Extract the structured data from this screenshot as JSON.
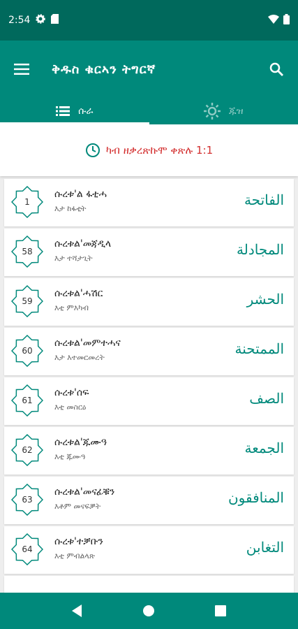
{
  "status": {
    "time": "2:54"
  },
  "app": {
    "title": "ቅዱስ ቁርኣን ትግርኛ"
  },
  "tabs": [
    {
      "label": "ሱራ"
    },
    {
      "label": "ጁዝ"
    }
  ],
  "banner": {
    "text": "ካብ ዘቃረጽኩሞ ቀጽሉ 1:1"
  },
  "surahs": [
    {
      "number": "1",
      "name": "ሱረቱ'ል ፋቲሓ",
      "meaning": "እታ ከፋቲት",
      "arabic": "الفاتحة"
    },
    {
      "number": "58",
      "name": "ሱረቱል'መጃዲላ",
      "meaning": "እታ ተሻታጊት",
      "arabic": "المجادلة"
    },
    {
      "number": "59",
      "name": "ሱረቱል'ሓሽር",
      "meaning": "እቲ ምእካብ",
      "arabic": "الحشر"
    },
    {
      "number": "60",
      "name": "ሱረቱል'መምተሓና",
      "meaning": "እታ እተመርመረት",
      "arabic": "الممتحنة"
    },
    {
      "number": "61",
      "name": "ሱረቱ'ሰፍ",
      "meaning": "እቲ መስርዕ",
      "arabic": "الصف"
    },
    {
      "number": "62",
      "name": "ሱረቱል'ጁሙዓ",
      "meaning": "እቲ ጁሙዓ",
      "arabic": "الجمعة"
    },
    {
      "number": "63",
      "name": "ሱረቱል'መናፊቑን",
      "meaning": "እቶም መናፍቓት",
      "arabic": "المنافقون"
    },
    {
      "number": "64",
      "name": "ሱረቱ'ተቓቡን",
      "meaning": "እቲ ምብልላጽ",
      "arabic": "التغابن"
    }
  ],
  "colors": {
    "primary": "#00897b",
    "primary_dark": "#00695c",
    "accent_red": "#d32f2f"
  },
  "icons": {
    "status": [
      "gear-icon",
      "sd-card-icon",
      "wifi-icon",
      "battery-icon"
    ],
    "toolbar": [
      "menu-icon",
      "search-icon"
    ],
    "tabs": [
      "list-icon",
      "sun-icon"
    ],
    "banner": "clock-icon",
    "nav": [
      "back-icon",
      "home-icon",
      "recents-icon"
    ]
  }
}
